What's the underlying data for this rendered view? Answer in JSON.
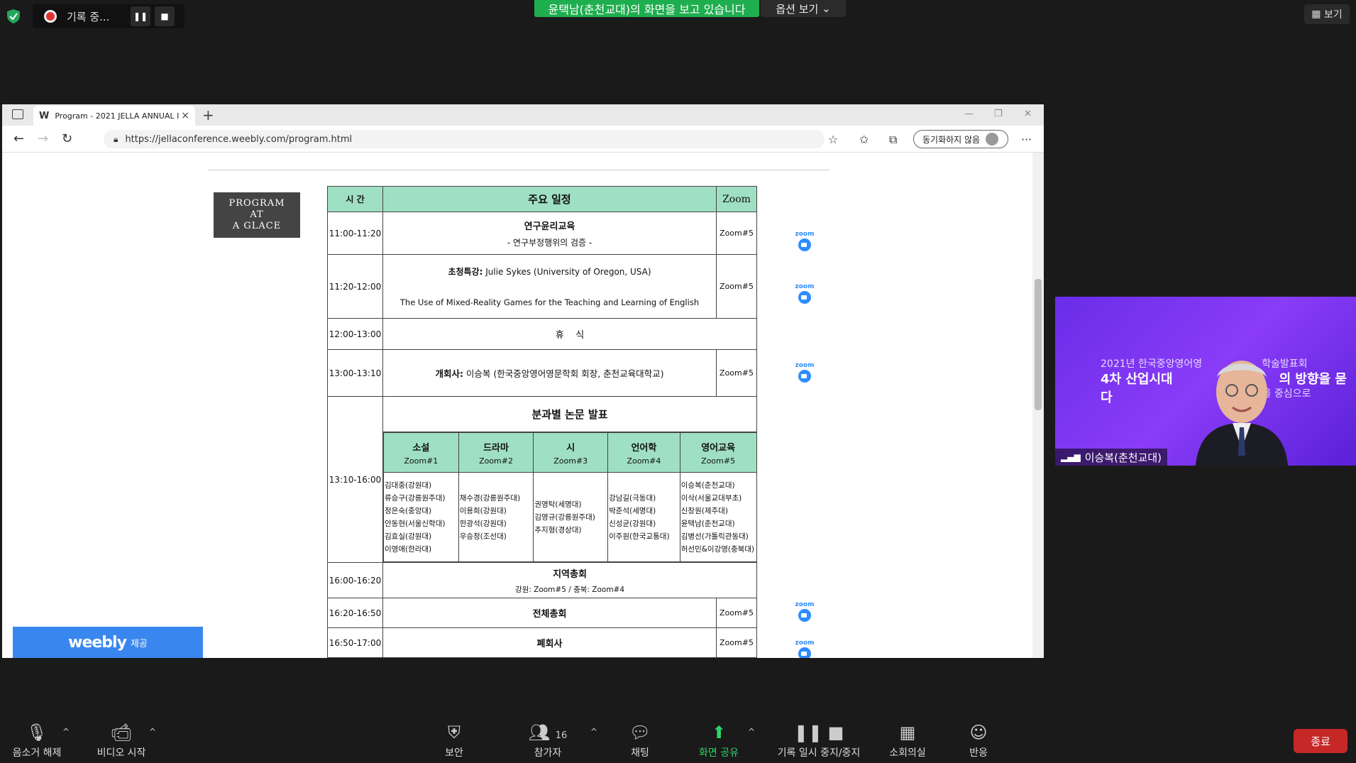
{
  "zoom_top": {
    "recording_label": "기록 중...",
    "viewing_banner": "윤택남(춘천교대)의 화면을 보고 있습니다",
    "view_options": "옵션 보기",
    "view_button": "보기"
  },
  "browser": {
    "tab_title": "Program - 2021 JELLA ANNUAL I",
    "url": "https://jellaconference.weebly.com/program.html",
    "sync_label": "동기화하지 않음"
  },
  "page": {
    "glance_lines": [
      "PROGRAM",
      "AT",
      "A GLACE"
    ],
    "weebly_logo": "weebly",
    "weebly_sub": "제공",
    "headers": {
      "time": "시 간",
      "main": "주요 일정",
      "zoom": "Zoom"
    },
    "rows": [
      {
        "time": "11:00-11:20",
        "title": "연구윤리교육",
        "sub": "- 연구부정행위의 검증 -",
        "zoom": "Zoom#5"
      },
      {
        "time": "11:20-12:00",
        "title_bold": "초청특강:",
        "title_rest": " Julie Sykes (University of Oregon, USA)",
        "sub": "The Use of Mixed-Reality Games for the Teaching and Learning of English",
        "zoom": "Zoom#5"
      },
      {
        "time": "12:00-13:00",
        "title": "휴    식"
      },
      {
        "time": "13:00-13:10",
        "title_bold": "개회사:",
        "title_rest": " 이승복 (한국중앙영어영문학회 회장, 춘천교육대학교)",
        "zoom": "Zoom#5"
      },
      {
        "time": "13:10-16:00",
        "title": "분과별 논문 발표"
      },
      {
        "time": "16:00-16:20",
        "title": "지역총회",
        "sub": "강원: Zoom#5 / 충북: Zoom#4"
      },
      {
        "time": "16:20-16:50",
        "title": "전체총회",
        "zoom": "Zoom#5"
      },
      {
        "time": "16:50-17:00",
        "title": "폐회사",
        "zoom": "Zoom#5"
      }
    ],
    "sessions": [
      {
        "name": "소설",
        "zoom": "Zoom#1",
        "people": [
          "김대중(강원대)",
          "류승구(강릉원주대)",
          "정은숙(중앙대)",
          "안동현(서울신학대)",
          "김효실(강원대)",
          "이영애(한라대)"
        ]
      },
      {
        "name": "드라마",
        "zoom": "Zoom#2",
        "people": [
          "채수경(강릉원주대)",
          "이용희(강원대)",
          "한광석(강원대)",
          "우승정(조선대)"
        ]
      },
      {
        "name": "시",
        "zoom": "Zoom#3",
        "people": [
          "권영탁(세명대)",
          "김영규(강릉원주대)",
          "추지형(경상대)"
        ]
      },
      {
        "name": "언어학",
        "zoom": "Zoom#4",
        "people": [
          "강남길(극동대)",
          "박준석(세명대)",
          "신성균(강원대)",
          "이주원(한국교통대)"
        ]
      },
      {
        "name": "영어교육",
        "zoom": "Zoom#5",
        "people": [
          "이승복(춘천교대)",
          "이삭(서울교대부초)",
          "신창원(제주대)",
          "윤택남(춘천교대)",
          "김병선(가톨릭관동대)",
          "허선민&이강영(충북대)"
        ]
      }
    ],
    "zoom_logo_text": "zoom"
  },
  "video": {
    "banner_line1": "2021년 한국중앙영어영",
    "banner_line1b": "학술발표회",
    "banner_line2": "4차 산업시대",
    "banner_line2b": "의 방향을 묻다",
    "banner_line3": "영어교육을 중심으로",
    "name": "이승복(춘천교대)"
  },
  "toolbar": {
    "mute": "음소거 해제",
    "video": "비디오 시작",
    "security": "보안",
    "participants": "참가자",
    "participant_count": "16",
    "chat": "채팅",
    "share": "화면 공유",
    "record": "기록 일시 중지/중지",
    "breakout": "소회의실",
    "reactions": "반응",
    "end": "종료"
  }
}
